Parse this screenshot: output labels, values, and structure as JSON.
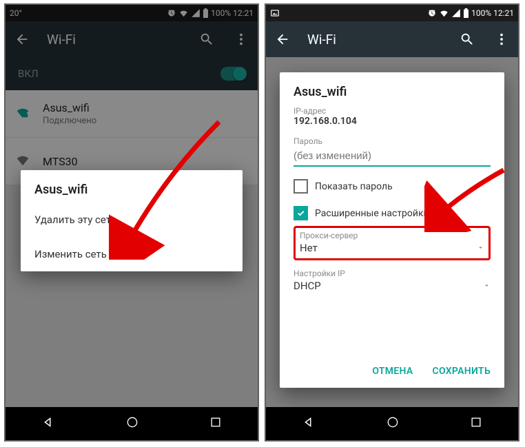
{
  "status": {
    "temp": "20°",
    "battery": "100%",
    "time": "12:21"
  },
  "appbar": {
    "title": "Wi-Fi"
  },
  "toggle": {
    "label": "ВКЛ"
  },
  "networks": [
    {
      "name": "Asus_wifi",
      "sub": "Подключено"
    },
    {
      "name": "MTS30",
      "sub": ""
    }
  ],
  "ctx": {
    "title": "Asus_wifi",
    "forget": "Удалить эту сеть",
    "modify": "Изменить сеть"
  },
  "dialog": {
    "title": "Asus_wifi",
    "ip_label": "IP-адрес",
    "ip_value": "192.168.0.104",
    "pw_label": "Пароль",
    "pw_placeholder": "(без изменений)",
    "show_pw": "Показать пароль",
    "advanced": "Расширенные настройки",
    "proxy_label": "Прокси-сервер",
    "proxy_value": "Нет",
    "ip_settings_label": "Настройки IP",
    "ip_settings_value": "DHCP",
    "cancel": "ОТМЕНА",
    "save": "СОХРАНИТЬ"
  }
}
